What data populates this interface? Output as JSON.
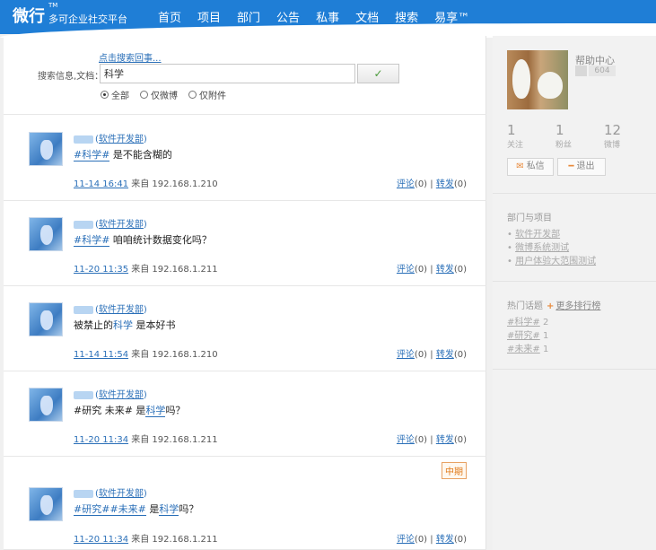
{
  "header": {
    "logo_big": "微行",
    "logo_tm": "TM",
    "logo_sub": "多可企业社交平台",
    "nav": [
      "首页",
      "项目",
      "部门",
      "公告",
      "私事",
      "文档",
      "搜索",
      "易享™"
    ]
  },
  "search": {
    "advanced_link": "点击搜索回事...",
    "label": "搜索信息,文档：",
    "value": "科学",
    "button": "✓",
    "options": [
      {
        "label": "全部",
        "selected": true
      },
      {
        "label": "仅微博",
        "selected": false
      },
      {
        "label": "仅附件",
        "selected": false
      }
    ]
  },
  "posts": [
    {
      "dept": "软件开发部",
      "content": [
        "#科学#",
        " 是不能含糊的"
      ],
      "time": "11-14 16:41",
      "from": " 来自 192.168.1.210",
      "comment": "评论",
      "comment_count": "(0)",
      "sep": " | ",
      "forward": "转发",
      "forward_count": "(0)"
    },
    {
      "dept": "软件开发部",
      "content": [
        "#科学#",
        " 咱咱统计数据变化吗？"
      ],
      "time": "11-20 11:35",
      "from": " 来自 192.168.1.211",
      "comment": "评论",
      "comment_count": "(0)",
      "sep": " | ",
      "forward": "转发",
      "forward_count": "(0)"
    },
    {
      "dept": "软件开发部",
      "content": [
        "被禁止的",
        "科学",
        " 是本好书"
      ],
      "time": "11-14 11:54",
      "from": " 来自 192.168.1.210",
      "comment": "评论",
      "comment_count": "(0)",
      "sep": " | ",
      "forward": "转发",
      "forward_count": "(0)"
    },
    {
      "dept": "软件开发部",
      "content": [
        "#研究 未来# 是",
        "科学",
        "吗？"
      ],
      "time": "11-20 11:34",
      "from": " 来自 192.168.1.211",
      "comment": "评论",
      "comment_count": "(0)",
      "sep": " | ",
      "forward": "转发",
      "forward_count": "(0)"
    },
    {
      "dept": "软件开发部",
      "badge": "中期",
      "content": [
        "#研究#",
        "#未来#",
        " 是",
        "科学",
        "吗？"
      ],
      "time": "11-20 11:34",
      "from": " 来自 192.168.1.211",
      "comment": "评论",
      "comment_count": "(0)",
      "sep": " | ",
      "forward": "转发",
      "forward_count": "(0)"
    }
  ],
  "sidebar": {
    "help": "帮助中心",
    "help_badge": "604",
    "stats": [
      {
        "num": "1",
        "label": "关注"
      },
      {
        "num": "1",
        "label": "粉丝"
      },
      {
        "num": "12",
        "label": "微博"
      }
    ],
    "buttons": [
      {
        "icon": "✉",
        "label": "私信"
      },
      {
        "icon": "━",
        "label": "退出"
      }
    ],
    "dept_title": "部门与项目",
    "dept_items": [
      "软件开发部",
      "微博系统测试",
      "用户体验大范围测试"
    ],
    "hot_title": "热门话题",
    "hot_more": "更多排行榜",
    "hot_items": [
      {
        "tag": "#科学#",
        "count": " 2"
      },
      {
        "tag": "#研究#",
        "count": " 1"
      },
      {
        "tag": "#未来#",
        "count": " 1"
      }
    ]
  }
}
